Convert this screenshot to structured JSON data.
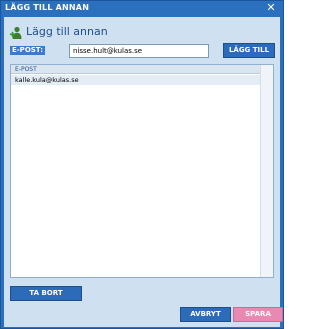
{
  "window": {
    "title": "LÄGG TILL ANNAN",
    "close_glyph": "✕"
  },
  "header": {
    "title": "Lägg till annan",
    "icon": "add-person-icon"
  },
  "form": {
    "email_label": "E-POST:",
    "email_value": "nisse.hult@kulas.se",
    "add_button": "LÄGG TILL"
  },
  "list": {
    "column_header": "E-POST",
    "rows": [
      "kalle.kula@kulas.se"
    ]
  },
  "buttons": {
    "remove": "TA BORT",
    "cancel": "AVBRYT",
    "save": "SPARA"
  },
  "colors": {
    "window_blue": "#2b6fbf",
    "panel": "#cfe0f1",
    "button_blue": "#2c6bb8",
    "save_pink": "#e789b0"
  }
}
